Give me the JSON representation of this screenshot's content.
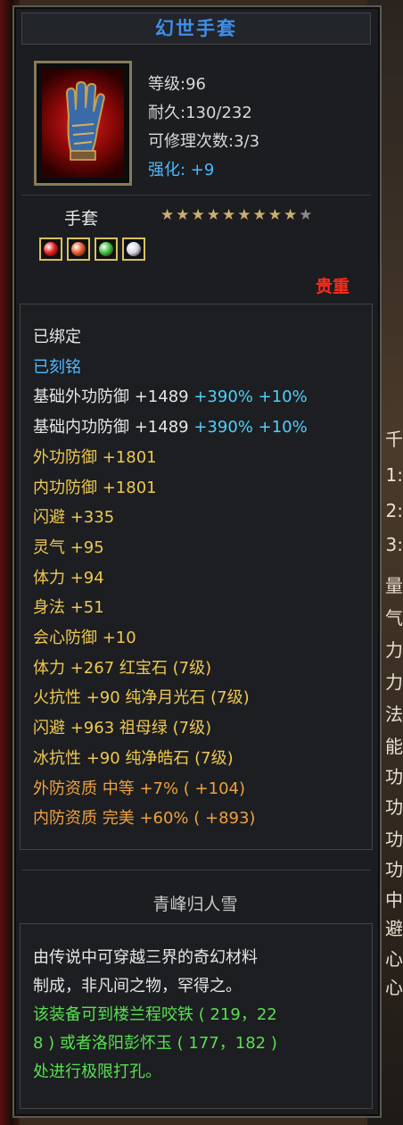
{
  "item": {
    "name": "幻世手套",
    "level": "等级:96",
    "durability": "耐久:130/232",
    "repair_count": "可修理次数:3/3",
    "enhance": "强化: +9",
    "type": "手套",
    "stars_filled": 9,
    "stars_total": 10,
    "rarity": "贵重",
    "gem_colors": [
      "#e82020",
      "#e86030",
      "#40c040",
      "#d8d8e8"
    ]
  },
  "attributes": [
    {
      "text": "已绑定",
      "style": "white"
    },
    {
      "text": "已刻铭",
      "style": "blue"
    },
    {
      "text": "基础外功防御 +1489 ",
      "extra_b": "+390% +10%",
      "style": "white"
    },
    {
      "text": "基础内功防御 +1489 ",
      "extra_b": "+390% +10%",
      "style": "white"
    },
    {
      "text": "外功防御 +1801",
      "style": "gold"
    },
    {
      "text": "内功防御 +1801",
      "style": "gold"
    },
    {
      "text": "闪避 +335",
      "style": "gold"
    },
    {
      "text": "灵气 +95",
      "style": "gold"
    },
    {
      "text": "体力 +94",
      "style": "gold"
    },
    {
      "text": "身法 +51",
      "style": "gold"
    },
    {
      "text": "会心防御 +10",
      "style": "gold"
    },
    {
      "text": "体力 +267 红宝石 (7级)",
      "style": "gold"
    },
    {
      "text": "火抗性 +90 纯净月光石 (7级)",
      "style": "gold"
    },
    {
      "text": "闪避 +963 祖母绿 (7级)",
      "style": "gold"
    },
    {
      "text": "冰抗性 +90 纯净皓石 (7级)",
      "style": "gold"
    },
    {
      "text": "外防资质   中等  +7% ( +104)",
      "style": "orange"
    },
    {
      "text": "内防资质   完美  +60% ( +893)",
      "style": "orange"
    }
  ],
  "set_name": "青峰归人雪",
  "description": {
    "flavor": "由传说中可穿越三界的奇幻材料\n制成，非凡间之物，罕得之。",
    "hint": "该装备可到楼兰程咬铁 ( 219，22\n8 ) 或者洛阳彭怀玉 ( 177，182 )\n处进行极限打孔。"
  },
  "background_right_glyphs": [
    "千",
    "1:",
    "2:",
    "3:",
    "量",
    "气",
    "力",
    "力",
    "法",
    "能",
    "功",
    "功",
    "功",
    "功",
    "中",
    "避",
    "心",
    "心"
  ]
}
